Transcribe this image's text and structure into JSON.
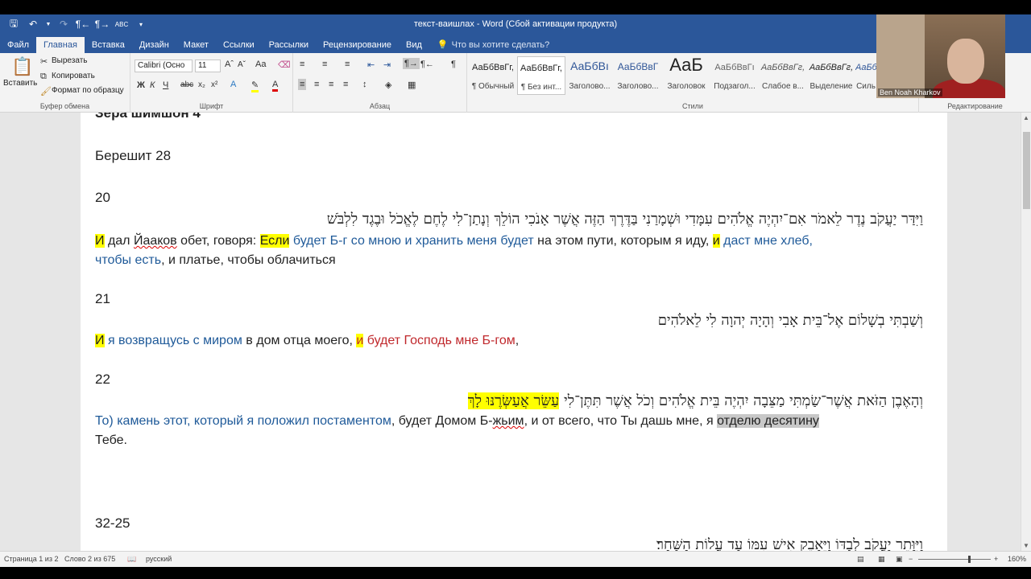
{
  "window": {
    "title": "текст-ваишлах - Word (Сбой активации продукта)"
  },
  "tabs": [
    {
      "label": "Файл",
      "active": false
    },
    {
      "label": "Главная",
      "active": true
    },
    {
      "label": "Вставка",
      "active": false
    },
    {
      "label": "Дизайн",
      "active": false
    },
    {
      "label": "Макет",
      "active": false
    },
    {
      "label": "Ссылки",
      "active": false
    },
    {
      "label": "Рассылки",
      "active": false
    },
    {
      "label": "Рецензирование",
      "active": false
    },
    {
      "label": "Вид",
      "active": false
    }
  ],
  "tell_me": "Что вы хотите сделать?",
  "ribbon": {
    "clipboard": {
      "paste": "Вставить",
      "cut": "Вырезать",
      "copy": "Копировать",
      "format_painter": "Формат по образцу",
      "label": "Буфер обмена"
    },
    "font": {
      "name": "Calibri (Осно",
      "size": "11",
      "label": "Шрифт"
    },
    "paragraph": {
      "label": "Абзац"
    },
    "styles": {
      "label": "Стили",
      "items": [
        {
          "preview": "АаБбВвГг,",
          "name": "¶ Обычный",
          "selected": false
        },
        {
          "preview": "АаБбВвГг,",
          "name": "¶ Без инт...",
          "selected": true
        },
        {
          "preview": "АаБбВı",
          "name": "Заголово...",
          "selected": false
        },
        {
          "preview": "АаБбВвГ",
          "name": "Заголово...",
          "selected": false
        },
        {
          "preview": "АаБ",
          "name": "Заголовок",
          "selected": false
        },
        {
          "preview": "АаБбВвГı",
          "name": "Подзагол...",
          "selected": false
        },
        {
          "preview": "АаБбВвГг,",
          "name": "Слабое в...",
          "selected": false
        },
        {
          "preview": "АаБбВвГг,",
          "name": "Выделение",
          "selected": false
        },
        {
          "preview": "АаБб",
          "name": "Силь",
          "selected": false
        }
      ]
    },
    "editing": {
      "label": "Редактирование"
    }
  },
  "webcam": {
    "name": "Ben Noah Kharkov"
  },
  "document": {
    "heading": "Зера шимшон 4",
    "chapter": "Берешит 28",
    "v20": {
      "num": "20",
      "hebrew": "וַיִּדַּר יַעֲקֹב נֶדֶר לֵאמֹר אִם־יִהְיֶה אֱלֹהִים עִמָּדִי וּשְׁמָרַנִי בַּדֶּרֶךְ הַזֶּה אֲשֶׁר אָנֹכִי הוֹלֵךְ וְנָתַן־לִי לֶחֶם לֶאֱכֹל וּבֶגֶד לִלְבֹּשׁ",
      "r1": "И",
      "r2": " дал ",
      "r3": "Йаакoв",
      "r4": " обет, говоря: ",
      "r5": "Если",
      "r6": " будет Б-г со мною и хранить меня будет",
      "r7": " на этом пути, которым я иду, ",
      "r8": "и",
      "r9": " даст мне хлеб,",
      "l2a": "чтобы есть",
      "l2b": ", и платье, чтобы облачиться"
    },
    "v21": {
      "num": "21",
      "hebrew": "וְשַׁבְתִּי בְשָׁלוֹם אֶל־בֵּית אָבִי וְהָיָה יְהוָה לִי לֵאלֹהִים",
      "r1": "И",
      "r2": " я возвращусь с миром",
      "r3": " в дом отца моего, ",
      "r4": "и",
      "r5": " будет Господь мне Б-гом",
      "r6": ","
    },
    "v22": {
      "num": "22",
      "hebrew_main": "וְהָאֶבֶן הַזֹּאת אֲשֶׁר־שַׂמְתִּי מַצֵּבָה יִהְיֶה בֵּית אֱלֹהִים וְכֹל אֲשֶׁר תִּתֶּן־לִי ",
      "hebrew_hl": "עַשֵּׂר אֲעַשְּׂרֶנּוּ לָךְ",
      "r1": "То) камень этот, который я положил постаментом",
      "r2": ", будет Домом Б-",
      "r3": "жьим",
      "r4": ", и от всего, что Ты дашь мне, я ",
      "r5": "отделю десятину",
      "l2": "Тебе."
    },
    "v32": {
      "num": "32-25",
      "hebrew": "וַיִּוָּתֵר יַעֲקֹב לְבַדּוֹ וַיֵּאָבֵק אִישׁ עִמּוֹ עַד עֲלוֹת הַשָּׁחַר׃"
    }
  },
  "status": {
    "page": "Страница 1 из 2",
    "words": "Слово 2 из 675",
    "lang": "русский",
    "zoom": "160%",
    "zoom_level": 1.6
  },
  "colors": {
    "accent": "#2b579a",
    "blue_text": "#1f5a99",
    "red_text": "#c0282c",
    "highlight": "#ffff00"
  }
}
